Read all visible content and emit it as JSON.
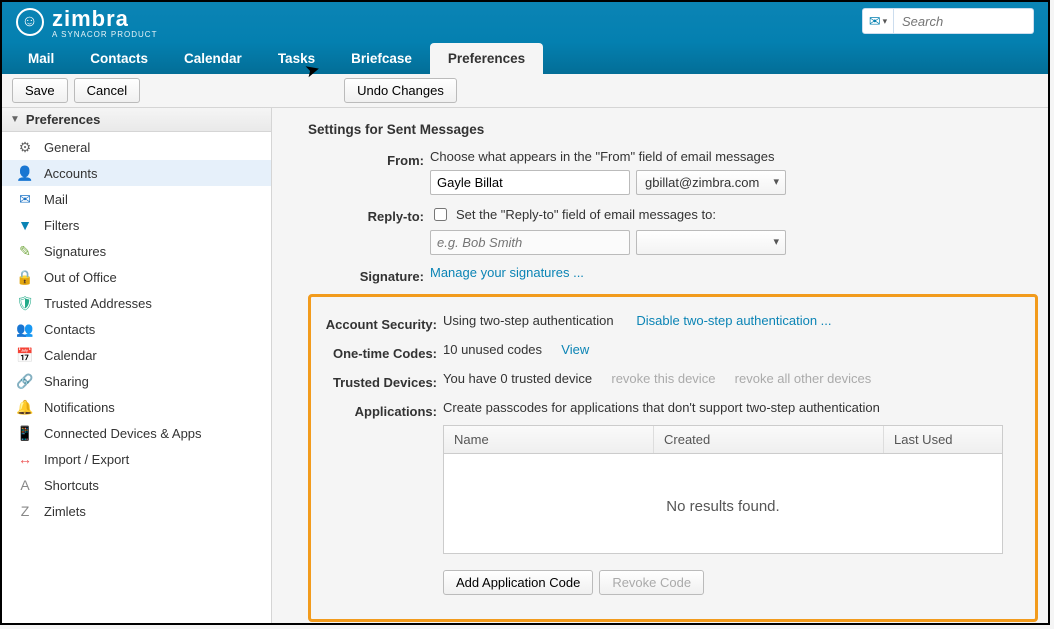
{
  "brand": {
    "name": "zimbra",
    "tagline": "A SYNACOR PRODUCT"
  },
  "search": {
    "placeholder": "Search"
  },
  "nav": {
    "tabs": [
      "Mail",
      "Contacts",
      "Calendar",
      "Tasks",
      "Briefcase",
      "Preferences"
    ],
    "active": "Preferences"
  },
  "toolbar": {
    "save": "Save",
    "cancel": "Cancel",
    "undo": "Undo Changes"
  },
  "sidebar": {
    "header": "Preferences",
    "items": [
      {
        "label": "General",
        "icon": "⚙",
        "color": "#666"
      },
      {
        "label": "Accounts",
        "icon": "👤",
        "color": "#1e74c6",
        "active": true
      },
      {
        "label": "Mail",
        "icon": "✉",
        "color": "#1e74c6"
      },
      {
        "label": "Filters",
        "icon": "▼",
        "color": "#0b84b5"
      },
      {
        "label": "Signatures",
        "icon": "✎",
        "color": "#7a4"
      },
      {
        "label": "Out of Office",
        "icon": "🔒",
        "color": "#e28"
      },
      {
        "label": "Trusted Addresses",
        "icon": "🛡",
        "color": "#2a8"
      },
      {
        "label": "Contacts",
        "icon": "👥",
        "color": "#888"
      },
      {
        "label": "Calendar",
        "icon": "📅",
        "color": "#1e74c6"
      },
      {
        "label": "Sharing",
        "icon": "🔗",
        "color": "#888"
      },
      {
        "label": "Notifications",
        "icon": "🔔",
        "color": "#e6b800"
      },
      {
        "label": "Connected Devices & Apps",
        "icon": "📱",
        "color": "#1e74c6"
      },
      {
        "label": "Import / Export",
        "icon": "↔",
        "color": "#e55"
      },
      {
        "label": "Shortcuts",
        "icon": "A",
        "color": "#888"
      },
      {
        "label": "Zimlets",
        "icon": "Z",
        "color": "#888"
      }
    ]
  },
  "settings": {
    "title": "Settings for Sent Messages",
    "from": {
      "label": "From:",
      "desc": "Choose what appears in the \"From\" field of email messages",
      "name_value": "Gayle Billat",
      "email_value": "gbillat@zimbra.com"
    },
    "replyto": {
      "label": "Reply-to:",
      "checkbox_label": "Set the \"Reply-to\" field of email messages to:",
      "placeholder": "e.g. Bob Smith"
    },
    "signature": {
      "label": "Signature:",
      "link": "Manage your signatures ..."
    },
    "security": {
      "label": "Account Security:",
      "status": "Using two-step authentication",
      "link": "Disable two-step authentication ..."
    },
    "codes": {
      "label": "One-time Codes:",
      "status": "10 unused codes",
      "link": "View"
    },
    "devices": {
      "label": "Trusted Devices:",
      "status": "You have 0 trusted device",
      "link1": "revoke this device",
      "link2": "revoke all other devices"
    },
    "apps": {
      "label": "Applications:",
      "desc": "Create passcodes for applications that don't support two-step authentication",
      "cols": {
        "c1": "Name",
        "c2": "Created",
        "c3": "Last Used"
      },
      "empty": "No results found.",
      "add_btn": "Add Application Code",
      "revoke_btn": "Revoke Code"
    }
  }
}
